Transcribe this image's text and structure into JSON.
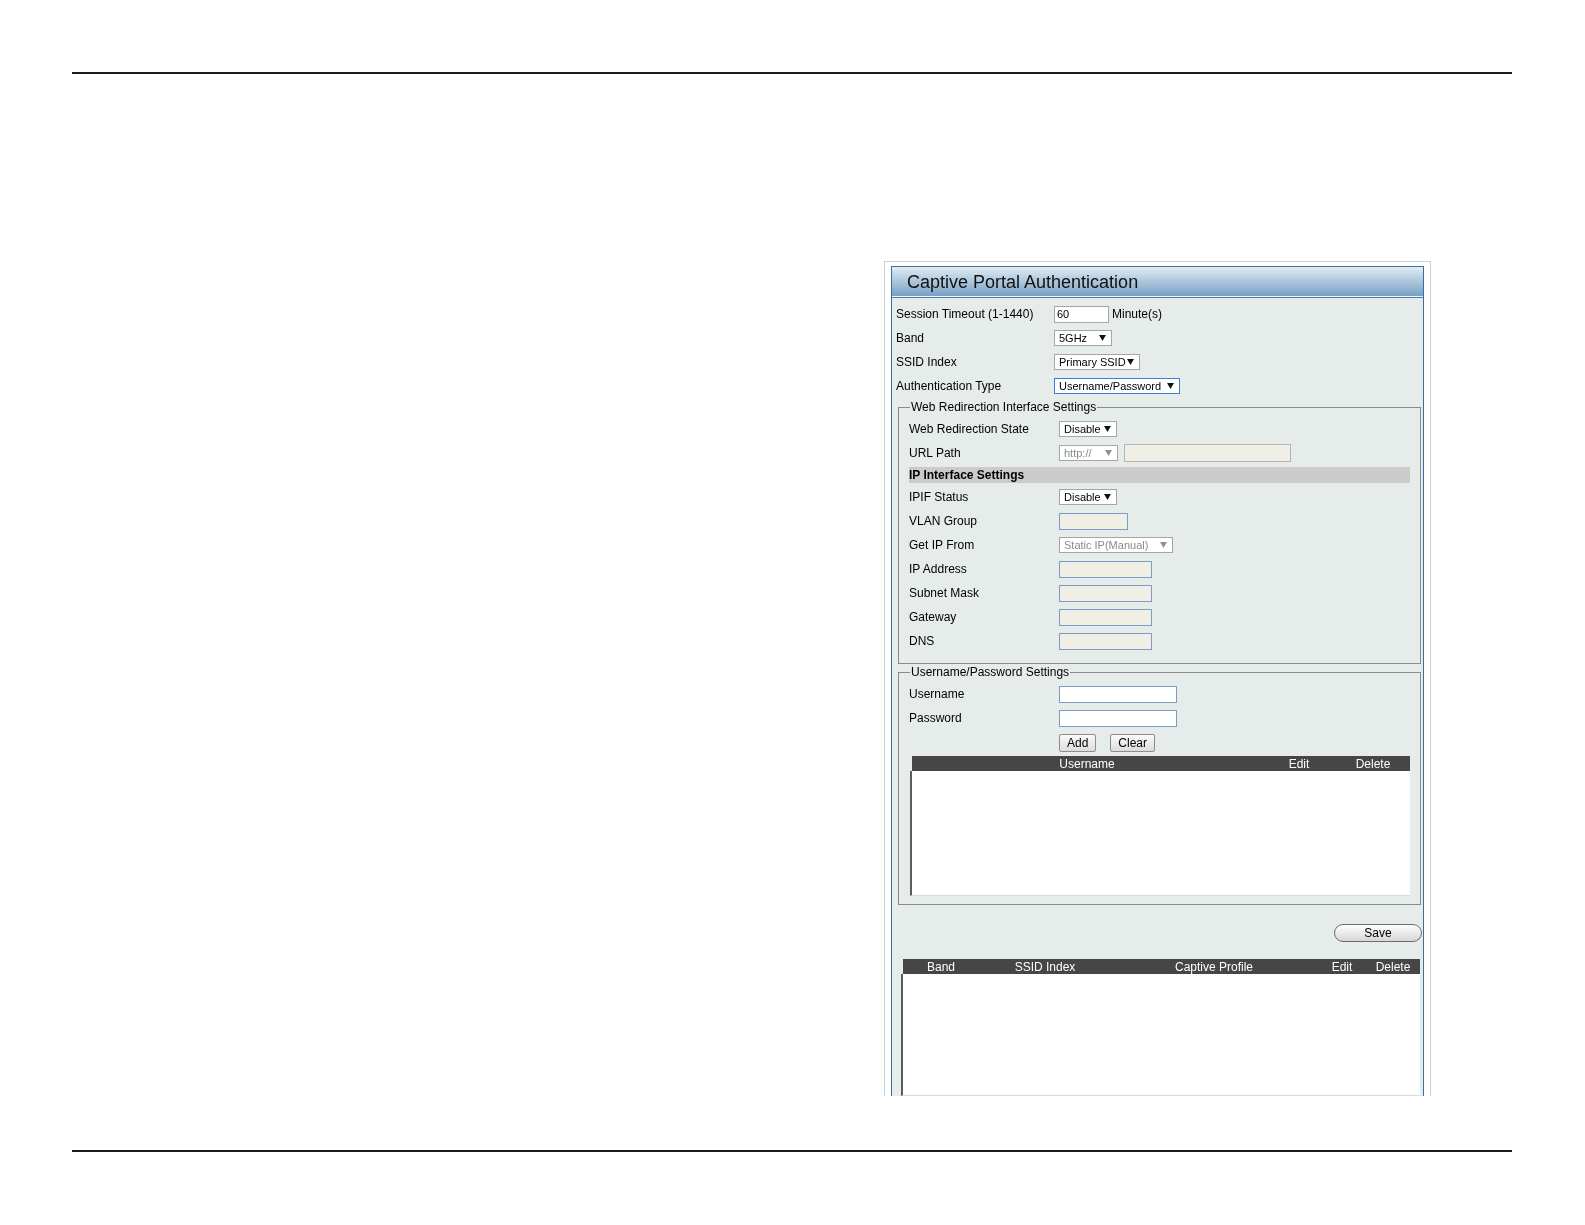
{
  "panel": {
    "title": "Captive Portal Authentication"
  },
  "settings": [
    {
      "kind": "input",
      "label": "Session Timeout (1-1440)",
      "value": "60",
      "suffix": "Minute(s)",
      "focused": false
    },
    {
      "kind": "select",
      "label": "Band",
      "value": "5GHz",
      "focused": false
    },
    {
      "kind": "select",
      "label": "SSID Index",
      "value": "Primary SSID",
      "focused": false
    },
    {
      "kind": "select",
      "label": "Authentication Type",
      "value": "Username/Password",
      "focused": true
    }
  ],
  "web_redirection": {
    "legend": "Web Redirection Interface Settings",
    "rows": [
      {
        "kind": "select",
        "label": "Web Redirection State",
        "value": "Disable",
        "disabled": false
      },
      {
        "kind": "select_input",
        "label": "URL Path",
        "value": "http://",
        "disabled": true
      },
      {
        "kind": "heading",
        "label": "IP Interface Settings"
      },
      {
        "kind": "select",
        "label": "IPIF Status",
        "value": "Disable",
        "disabled": false
      },
      {
        "kind": "input",
        "label": "VLAN Group",
        "disabled": true
      },
      {
        "kind": "select",
        "label": "Get IP From",
        "value": "Static IP(Manual)",
        "disabled": true
      },
      {
        "kind": "input",
        "label": "IP Address",
        "disabled": true
      },
      {
        "kind": "input",
        "label": "Subnet Mask",
        "disabled": true
      },
      {
        "kind": "input",
        "label": "Gateway",
        "disabled": true
      },
      {
        "kind": "input",
        "label": "DNS",
        "disabled": true
      }
    ]
  },
  "user_settings": {
    "legend": "Username/Password Settings",
    "rows": [
      {
        "kind": "input",
        "label": "Username",
        "disabled": false
      },
      {
        "kind": "input",
        "label": "Password",
        "disabled": false
      }
    ],
    "buttons": [
      "Add",
      "Clear"
    ],
    "table": {
      "columns": [
        "Username",
        "Edit",
        "Delete"
      ]
    }
  },
  "save_button": "Save",
  "profile_table": {
    "columns": [
      "Band",
      "SSID Index",
      "Captive Profile",
      "Edit",
      "Delete"
    ]
  }
}
